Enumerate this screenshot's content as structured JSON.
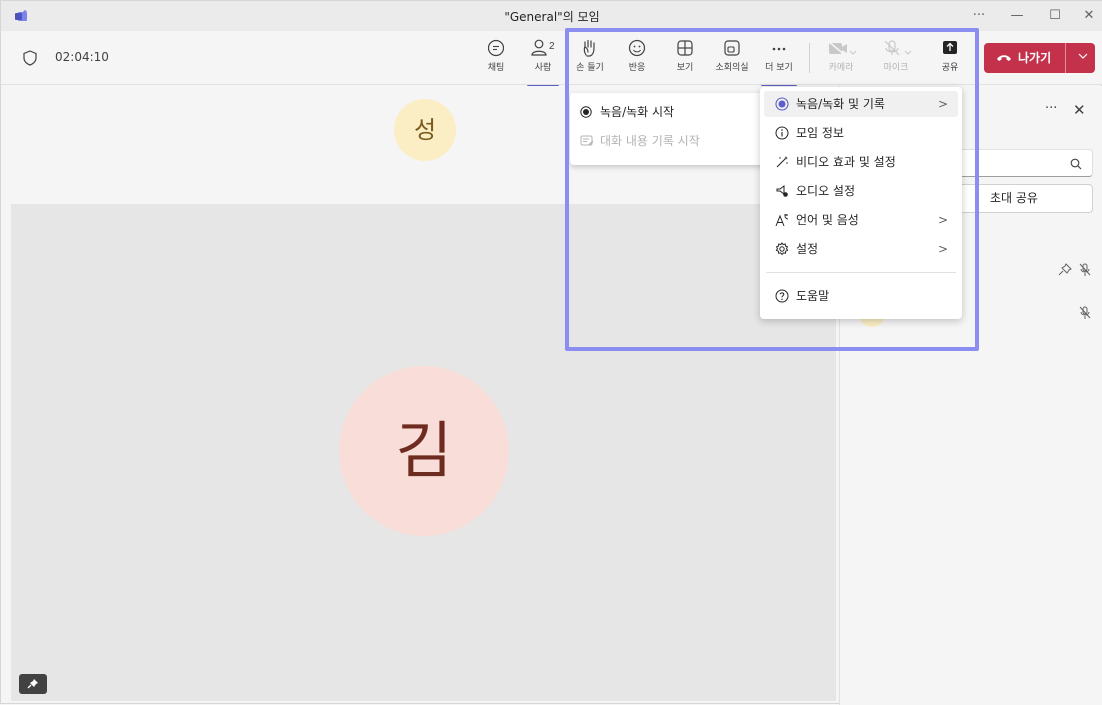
{
  "window": {
    "title": "\"General\"의 모임",
    "controls": {
      "more": "···",
      "minimize": "—",
      "maximize": "☐",
      "close": "✕"
    }
  },
  "toolbar": {
    "timer": "02:04:10",
    "chat": {
      "label": "채팅"
    },
    "people": {
      "label": "사람",
      "count": "2"
    },
    "raise_hand": {
      "label": "손 들기"
    },
    "react": {
      "label": "반응"
    },
    "view": {
      "label": "보기"
    },
    "rooms": {
      "label": "소회의실"
    },
    "more": {
      "label": "더 보기"
    },
    "camera": {
      "label": "카메라"
    },
    "mic": {
      "label": "마이크"
    },
    "share": {
      "label": "공유"
    },
    "leave": {
      "label": "나가기"
    }
  },
  "stage": {
    "small_avatar": "성",
    "big_avatar": "김"
  },
  "panel": {
    "more": "···",
    "close": "✕",
    "share_text": "초대 공유"
  },
  "submenu": {
    "items": [
      {
        "label": "녹음/녹화 시작",
        "disabled": false
      },
      {
        "label": "대화 내용 기록 시작",
        "disabled": true
      }
    ]
  },
  "menu": {
    "items": [
      {
        "label": "녹음/녹화 및 기록",
        "submenu": true,
        "active": true
      },
      {
        "label": "모임 정보",
        "submenu": false
      },
      {
        "label": "비디오 효과 및 설정",
        "submenu": false
      },
      {
        "label": "오디오 설정",
        "submenu": false
      },
      {
        "label": "언어 및 음성",
        "submenu": true
      },
      {
        "label": "설정",
        "submenu": true
      },
      {
        "label": "도움말",
        "submenu": false
      }
    ],
    "chevron": ">"
  },
  "colors": {
    "accent": "#5b5fc7",
    "leave_red": "#c4314b",
    "highlight": "#8b8df0",
    "avatar_small_bg": "#fbeec4",
    "avatar_big_bg": "#f9ddd8"
  }
}
